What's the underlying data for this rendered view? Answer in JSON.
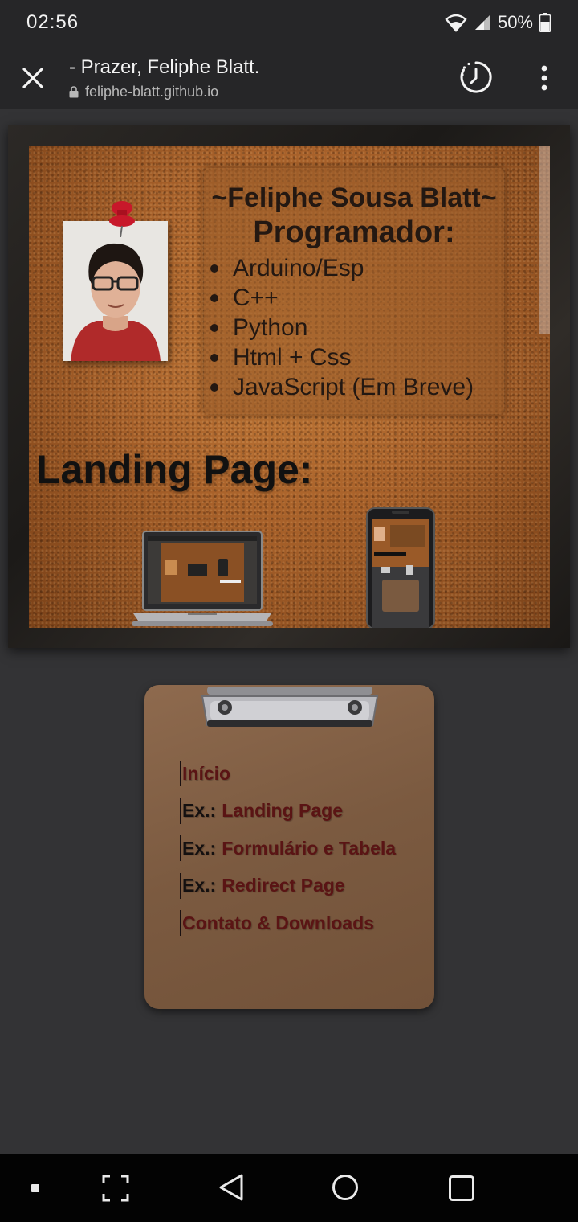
{
  "status_bar": {
    "time": "02:56",
    "battery": "50%",
    "icons": [
      "wifi-icon",
      "signal-icon",
      "battery-icon"
    ]
  },
  "browser": {
    "close_icon": "close-icon",
    "page_title": "- Prazer, Feliphe Blatt.",
    "url": "feliphe-blatt.github.io",
    "lock_icon": "lock-icon",
    "history_icon": "history-icon",
    "menu_icon": "more-vert-icon"
  },
  "hero": {
    "name": "~Feliphe Sousa Blatt~",
    "role": "Programador:",
    "skills": [
      "Arduino/Esp",
      "C++",
      "Python",
      "Html + Css",
      "JavaScript (Em Breve)"
    ],
    "landing_title": "Landing Page:"
  },
  "menu": {
    "items": [
      {
        "prefix": "",
        "label": "Início"
      },
      {
        "prefix": "Ex.:",
        "label": "Landing Page"
      },
      {
        "prefix": "Ex.:",
        "label": "Formulário e Tabela"
      },
      {
        "prefix": "Ex.:",
        "label": "Redirect Page"
      },
      {
        "prefix": "",
        "label": "Contato & Downloads"
      }
    ]
  },
  "system_nav": {
    "icons": [
      "recents-dot-icon",
      "screenshot-icon",
      "back-icon",
      "home-icon",
      "overview-icon"
    ]
  },
  "colors": {
    "background": "#333335",
    "toolbar": "#262628",
    "cork": "#a8612a",
    "clipboard": "#7b5a40",
    "link": "#5a1414"
  }
}
